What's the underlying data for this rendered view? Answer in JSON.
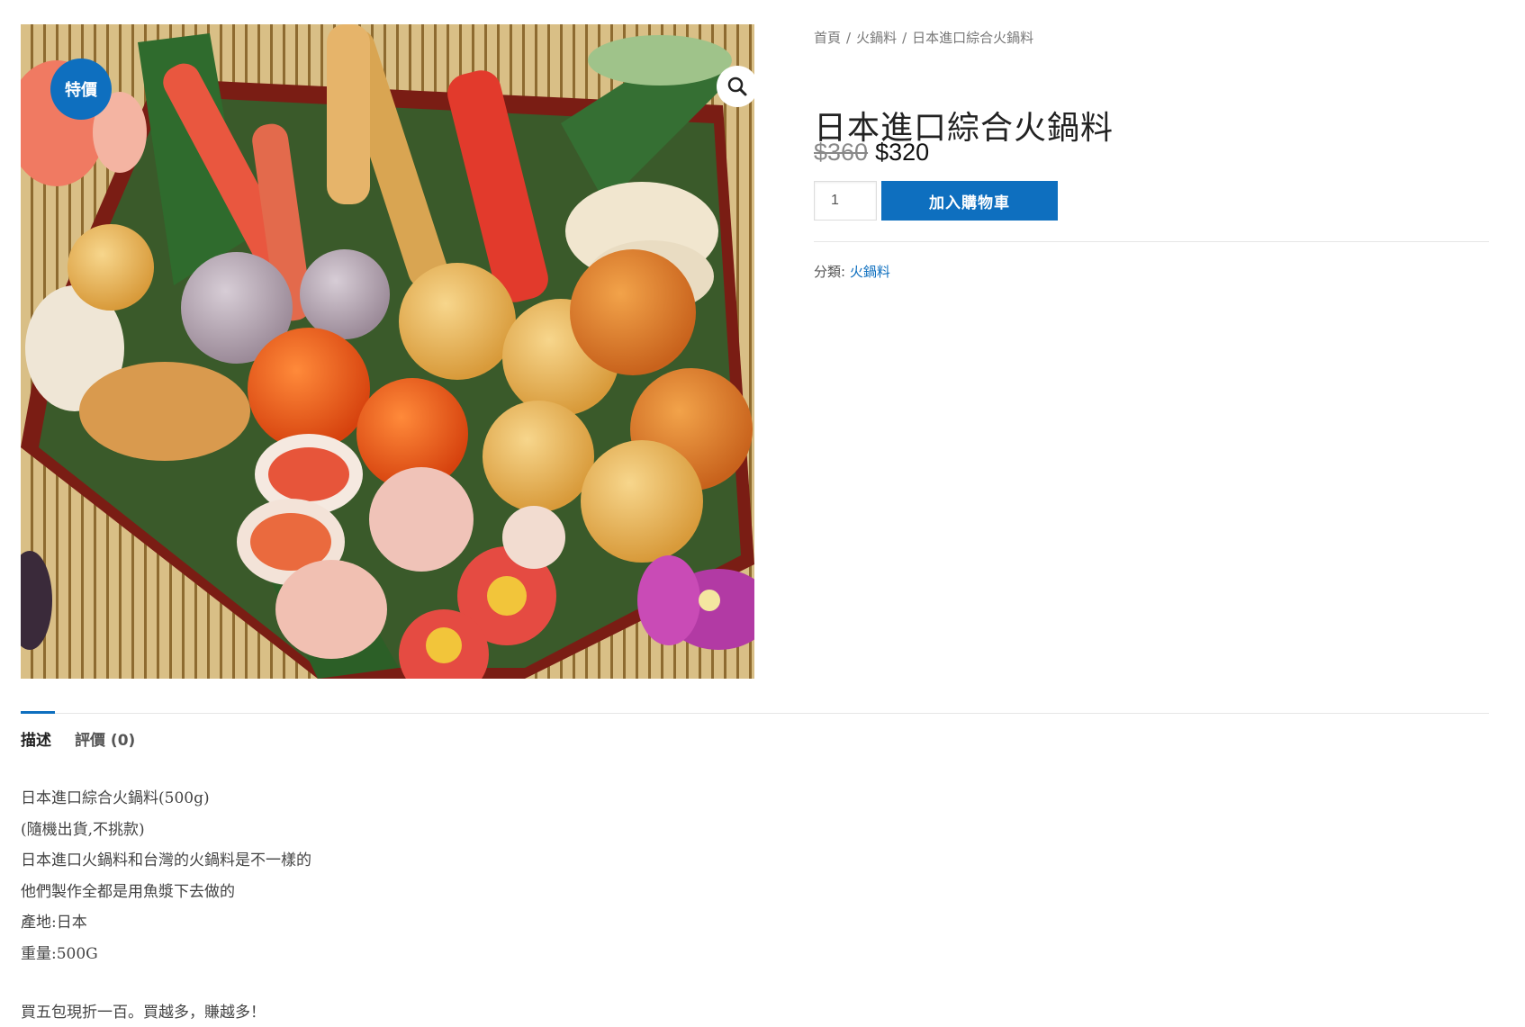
{
  "product": {
    "badge": "特價",
    "image_alt": "日本進口綜合火鍋料"
  },
  "breadcrumb": {
    "items": [
      "首頁",
      "火鍋料",
      "日本進口綜合火鍋料"
    ],
    "separator": "/"
  },
  "title": "日本進口綜合火鍋料",
  "price": {
    "old": "$360",
    "new": "$320"
  },
  "cart": {
    "quantity": "1",
    "add_label": "加入購物車"
  },
  "meta": {
    "category_label": "分類:",
    "category_value": "火鍋料"
  },
  "tabs": [
    {
      "label": "描述",
      "active": true
    },
    {
      "label": "評價 (0)",
      "active": false
    }
  ],
  "description": {
    "lines": [
      "日本進口綜合火鍋料(500g)",
      "(隨機出貨,不挑款)",
      "日本進口火鍋料和台灣的火鍋料是不一樣的",
      "他們製作全都是用魚漿下去做的",
      "產地:日本",
      "重量:500G"
    ],
    "promo": "買五包現折一百。買越多，賺越多！"
  },
  "colors": {
    "accent": "#0e6fbf",
    "divider": "#e6e6e6"
  }
}
